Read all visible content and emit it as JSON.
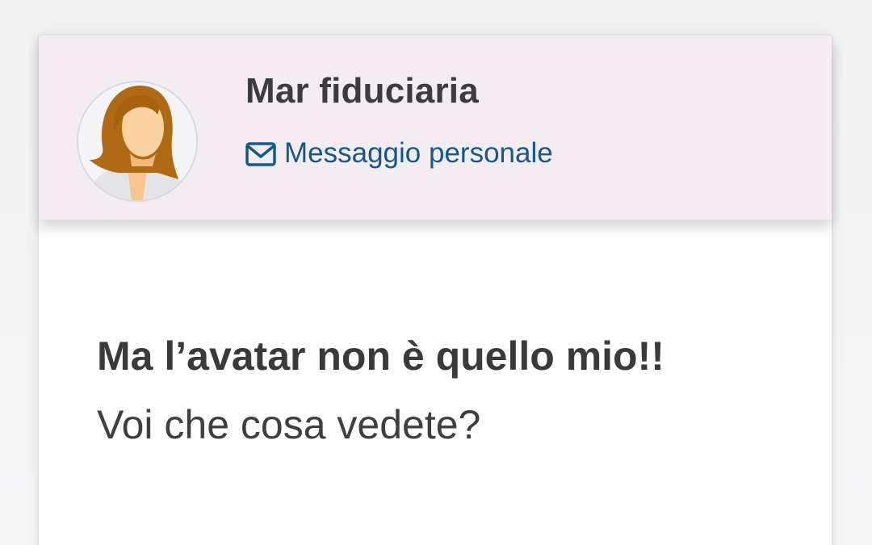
{
  "post": {
    "author": {
      "name": "Mar fiduciaria",
      "avatar_icon": "female-avatar-icon",
      "message_link_label": "Messaggio personale",
      "message_icon": "envelope-icon"
    },
    "content": {
      "headline": "Ma l’avatar non è quello mio!!",
      "text": "Voi che cosa vedete?"
    }
  },
  "colors": {
    "header_bg": "#f4ecf3",
    "link": "#14598a",
    "text": "#3c3c3f",
    "hair": "#b06a14",
    "skin": "#f9c994"
  }
}
